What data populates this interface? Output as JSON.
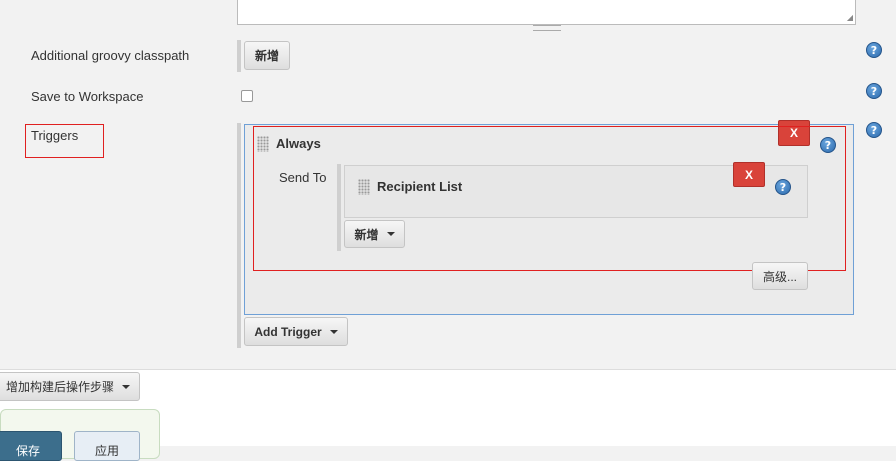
{
  "rows": {
    "groovy_label": "Additional groovy classpath",
    "groovy_add": "新增",
    "workspace_label": "Save to Workspace",
    "triggers_label": "Triggers"
  },
  "trigger": {
    "name": "Always",
    "delete": "X",
    "send_to_label": "Send To",
    "recipient": {
      "name": "Recipient List",
      "delete": "X"
    },
    "add_recipient": "新增",
    "advanced": "高级..."
  },
  "add_trigger": "Add Trigger",
  "post_build_add": "增加构建后操作步骤",
  "footer": {
    "save": "保存",
    "apply": "应用"
  },
  "help_glyph": "?",
  "icons": [
    "help-icon",
    "drag-handle-icon",
    "dropdown-caret-icon",
    "resize-grip-icon"
  ],
  "colors": {
    "page_bg": "#f2f2f2",
    "delete_red": "#d9433a",
    "help_blue": "#2c6aad",
    "trigger_border": "#6fa0d6",
    "annotation_red": "#e02020"
  }
}
